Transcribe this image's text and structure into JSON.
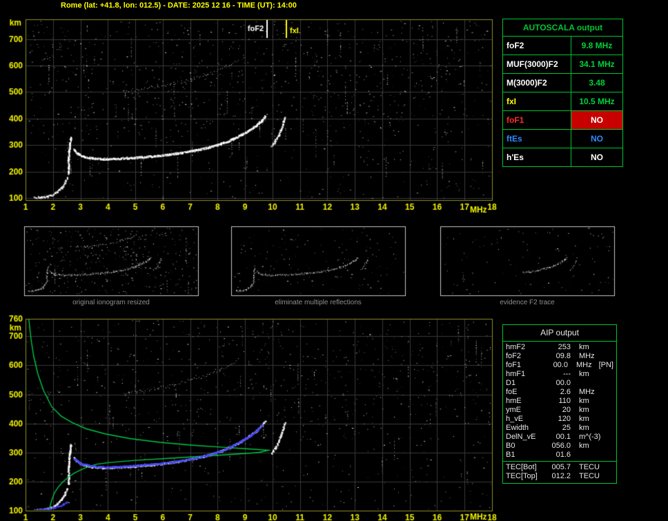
{
  "header": {
    "title": "Rome (lat: +41.8, lon: 012.5) - DATE: 2025 12 16 - TIME (UT): 14:00"
  },
  "colors": {
    "background": "#000000",
    "title_yellow": "#ffff00",
    "axis_text": "#f2f200",
    "plot_border": "#8f8f2a",
    "grid": "#3a3a3a",
    "table_green": "#00c432",
    "value_green": "#00d23c",
    "white": "#ffffff",
    "red": "#ff2a2a",
    "red_bg": "#c80000",
    "blue": "#2e8bff",
    "trace_blue": "#4646ff",
    "profile_green": "#00c846",
    "caption_gray": "#8f8f8f",
    "thumb_border": "#c8c8c8"
  },
  "autoscala": {
    "title": "AUTOSCALA output",
    "rows": [
      {
        "label": "foF2",
        "value": "9.8 MHz"
      },
      {
        "label": "MUF(3000)F2",
        "value": "34.1 MHz"
      },
      {
        "label": "M(3000)F2",
        "value": "3.48"
      },
      {
        "label": "fxI",
        "value": "10.5 MHz"
      },
      {
        "label": "foF1",
        "value": "NO"
      },
      {
        "label": "ftEs",
        "value": "NO"
      },
      {
        "label": "h'Es",
        "value": "NO"
      }
    ]
  },
  "thumbnails": [
    {
      "caption": "original ionogram resized"
    },
    {
      "caption": "eliminate multiple reflections"
    },
    {
      "caption": "evidence F2 trace"
    }
  ],
  "aip": {
    "title": "AIP output",
    "rows": [
      {
        "name": "hmF2",
        "value": "253",
        "unit": "km",
        "note": ""
      },
      {
        "name": "foF2",
        "value": "09.8",
        "unit": "MHz",
        "note": ""
      },
      {
        "name": "foF1",
        "value": "00.0",
        "unit": "MHz",
        "note": "[PN]"
      },
      {
        "name": "hmF1",
        "value": "---",
        "unit": "km",
        "note": ""
      },
      {
        "name": "D1",
        "value": "00.0",
        "unit": "",
        "note": ""
      },
      {
        "name": "foE",
        "value": "2.6",
        "unit": "MHz",
        "note": ""
      },
      {
        "name": "hmE",
        "value": "110",
        "unit": "km",
        "note": ""
      },
      {
        "name": "ymE",
        "value": "20",
        "unit": "km",
        "note": ""
      },
      {
        "name": "h_vE",
        "value": "120",
        "unit": "km",
        "note": ""
      },
      {
        "name": "Ewidth",
        "value": "25",
        "unit": "km",
        "note": ""
      },
      {
        "name": "DelN_vE",
        "value": "00.1",
        "unit": "m^(-3)",
        "note": ""
      },
      {
        "name": "B0",
        "value": "056.0",
        "unit": "km",
        "note": ""
      },
      {
        "name": "B1",
        "value": "01.6",
        "unit": "",
        "note": ""
      }
    ],
    "tec_rows": [
      {
        "name": "TEC[Bot]",
        "value": "005.7",
        "unit": "TECU"
      },
      {
        "name": "TEC[Top]",
        "value": "012.2",
        "unit": "TECU"
      }
    ]
  },
  "chart_data": [
    {
      "type": "scatter",
      "title": "ionogram with autoscaled critical frequencies",
      "xlabel": "MHz",
      "ylabel": "km",
      "xlim": [
        1,
        18
      ],
      "ylim": [
        92,
        775
      ],
      "x_ticks": [
        1,
        2,
        3,
        4,
        5,
        6,
        7,
        8,
        9,
        10,
        11,
        12,
        13,
        14,
        15,
        16,
        17,
        18
      ],
      "y_ticks": [
        700,
        600,
        500,
        400,
        300,
        200,
        100
      ],
      "grid": true,
      "markers": [
        {
          "label": "foF2",
          "mhz": 9.8,
          "color": "#ffffff",
          "side": "left"
        },
        {
          "label": "fxI",
          "mhz": 10.5,
          "color": "#ffff00",
          "side": "right"
        }
      ],
      "traces": {
        "e_trace": [
          [
            1.3,
            104
          ],
          [
            1.55,
            104
          ],
          [
            1.8,
            108
          ],
          [
            2.0,
            115
          ],
          [
            2.15,
            126
          ],
          [
            2.3,
            140
          ],
          [
            2.42,
            158
          ],
          [
            2.5,
            178
          ]
        ],
        "cusp": [
          [
            2.56,
            195
          ],
          [
            2.55,
            220
          ],
          [
            2.55,
            248
          ],
          [
            2.57,
            275
          ],
          [
            2.6,
            300
          ],
          [
            2.64,
            328
          ]
        ],
        "f_trace": [
          [
            2.75,
            285
          ],
          [
            2.9,
            268
          ],
          [
            3.1,
            258
          ],
          [
            3.4,
            252
          ],
          [
            3.8,
            249
          ],
          [
            4.2,
            250
          ],
          [
            4.7,
            252
          ],
          [
            5.2,
            256
          ],
          [
            5.7,
            260
          ],
          [
            6.2,
            266
          ],
          [
            6.7,
            273
          ],
          [
            7.2,
            282
          ],
          [
            7.7,
            294
          ],
          [
            8.1,
            306
          ],
          [
            8.5,
            322
          ],
          [
            8.85,
            340
          ],
          [
            9.15,
            358
          ],
          [
            9.4,
            376
          ],
          [
            9.6,
            394
          ],
          [
            9.72,
            410
          ]
        ],
        "x_trace": [
          [
            9.95,
            298
          ],
          [
            10.08,
            315
          ],
          [
            10.2,
            338
          ],
          [
            10.3,
            362
          ],
          [
            10.38,
            386
          ],
          [
            10.44,
            405
          ]
        ],
        "second_hop": [
          [
            4.6,
            505
          ],
          [
            5.2,
            512
          ],
          [
            5.8,
            522
          ],
          [
            6.4,
            534
          ],
          [
            7.0,
            549
          ],
          [
            7.6,
            566
          ],
          [
            8.1,
            585
          ],
          [
            8.5,
            605
          ],
          [
            8.75,
            620
          ]
        ]
      }
    },
    {
      "type": "scatter",
      "title": "ionogram with restored trace and electron density profile",
      "xlabel": "MHz",
      "ylabel": "km",
      "xlim": [
        1,
        18
      ],
      "ylim": [
        100,
        760
      ],
      "x_ticks": [
        1,
        2,
        3,
        4,
        5,
        6,
        7,
        8,
        9,
        10,
        11,
        12,
        13,
        14,
        15,
        16,
        17,
        18
      ],
      "y_ticks": [
        760,
        700,
        600,
        500,
        400,
        300,
        200,
        100
      ],
      "grid": true,
      "traces": {
        "green_profile": [
          [
            1.12,
            758
          ],
          [
            1.2,
            690
          ],
          [
            1.3,
            630
          ],
          [
            1.45,
            570
          ],
          [
            1.65,
            515
          ],
          [
            1.95,
            458
          ],
          [
            2.3,
            425
          ],
          [
            2.7,
            403
          ],
          [
            3.2,
            382
          ],
          [
            3.9,
            364
          ],
          [
            4.8,
            348
          ],
          [
            5.9,
            335
          ],
          [
            7.1,
            325
          ],
          [
            8.2,
            318
          ],
          [
            9.2,
            312
          ],
          [
            9.85,
            308
          ],
          [
            9.5,
            300
          ],
          [
            8.6,
            294
          ],
          [
            7.4,
            287
          ],
          [
            6.2,
            280
          ],
          [
            5.0,
            273
          ],
          [
            4.1,
            266
          ],
          [
            3.6,
            260
          ],
          [
            3.25,
            250
          ],
          [
            3.0,
            240
          ],
          [
            2.75,
            228
          ],
          [
            2.55,
            214
          ],
          [
            2.35,
            198
          ],
          [
            2.18,
            180
          ],
          [
            2.05,
            160
          ],
          [
            1.97,
            140
          ],
          [
            1.9,
            118
          ],
          [
            1.86,
            103
          ]
        ],
        "blue_trace": [
          [
            2.75,
            280
          ],
          [
            3.0,
            263
          ],
          [
            3.4,
            255
          ],
          [
            3.9,
            251
          ],
          [
            4.5,
            253
          ],
          [
            5.1,
            257
          ],
          [
            5.7,
            262
          ],
          [
            6.3,
            268
          ],
          [
            6.9,
            277
          ],
          [
            7.5,
            289
          ],
          [
            8.0,
            303
          ],
          [
            8.45,
            320
          ],
          [
            8.85,
            340
          ],
          [
            9.2,
            360
          ],
          [
            9.45,
            380
          ],
          [
            9.62,
            398
          ]
        ],
        "blue_e": [
          [
            1.3,
            104
          ],
          [
            1.7,
            106
          ],
          [
            2.05,
            112
          ],
          [
            2.35,
            122
          ],
          [
            2.5,
            132
          ]
        ]
      }
    }
  ]
}
